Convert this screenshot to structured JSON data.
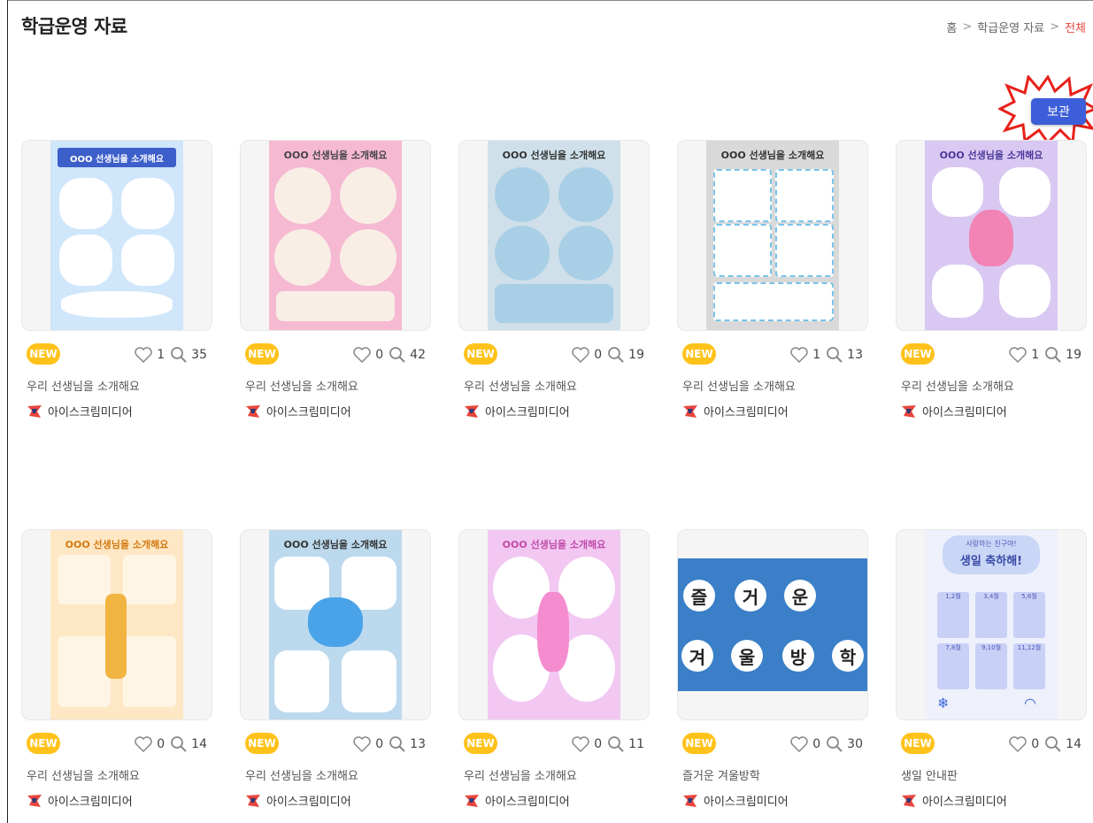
{
  "page": {
    "title": "학급운영 자료"
  },
  "breadcrumb": {
    "home": "홈",
    "section": "학급운영 자료",
    "current": "전체"
  },
  "actions": {
    "save_label": "보관"
  },
  "badge_label": "NEW",
  "cards": [
    {
      "title": "우리 선생님을 소개해요",
      "author": "아이스크림미디어",
      "likes": "1",
      "comments": "35",
      "poster_title": "OOO 선생님을 소개해요"
    },
    {
      "title": "우리 선생님을 소개해요",
      "author": "아이스크림미디어",
      "likes": "0",
      "comments": "42",
      "poster_title": "OOO 선생님을 소개해요"
    },
    {
      "title": "우리 선생님을 소개해요",
      "author": "아이스크림미디어",
      "likes": "0",
      "comments": "19",
      "poster_title": "OOO 선생님을 소개해요"
    },
    {
      "title": "우리 선생님을 소개해요",
      "author": "아이스크림미디어",
      "likes": "1",
      "comments": "13",
      "poster_title": "OOO 선생님을 소개해요"
    },
    {
      "title": "우리 선생님을 소개해요",
      "author": "아이스크림미디어",
      "likes": "1",
      "comments": "19",
      "poster_title": "OOO 선생님을 소개해요"
    },
    {
      "title": "우리 선생님을 소개해요",
      "author": "아이스크림미디어",
      "likes": "0",
      "comments": "14",
      "poster_title": "OOO 선생님을 소개해요"
    },
    {
      "title": "우리 선생님을 소개해요",
      "author": "아이스크림미디어",
      "likes": "0",
      "comments": "13",
      "poster_title": "OOO 선생님을 소개해요"
    },
    {
      "title": "우리 선생님을 소개해요",
      "author": "아이스크림미디어",
      "likes": "0",
      "comments": "11",
      "poster_title": "OOO 선생님을 소개해요"
    },
    {
      "title": "즐거운 겨울방학",
      "author": "아이스크림미디어",
      "likes": "0",
      "comments": "30",
      "poster_chars": [
        "즐",
        "거",
        "운",
        "겨",
        "울",
        "방",
        "학"
      ]
    },
    {
      "title": "생일 안내판",
      "author": "아이스크림미디어",
      "likes": "0",
      "comments": "14",
      "poster_subtitle": "사랑하는 친구야!",
      "poster_title": "생일 축하해!",
      "months": [
        "1,2월",
        "3,4월",
        "5,6월",
        "7,8월",
        "9,10월",
        "11,12월"
      ]
    }
  ],
  "colors": {
    "accent": "#e8453c",
    "save_button": "#3c5fd9",
    "new_badge": "#ffc21a"
  }
}
